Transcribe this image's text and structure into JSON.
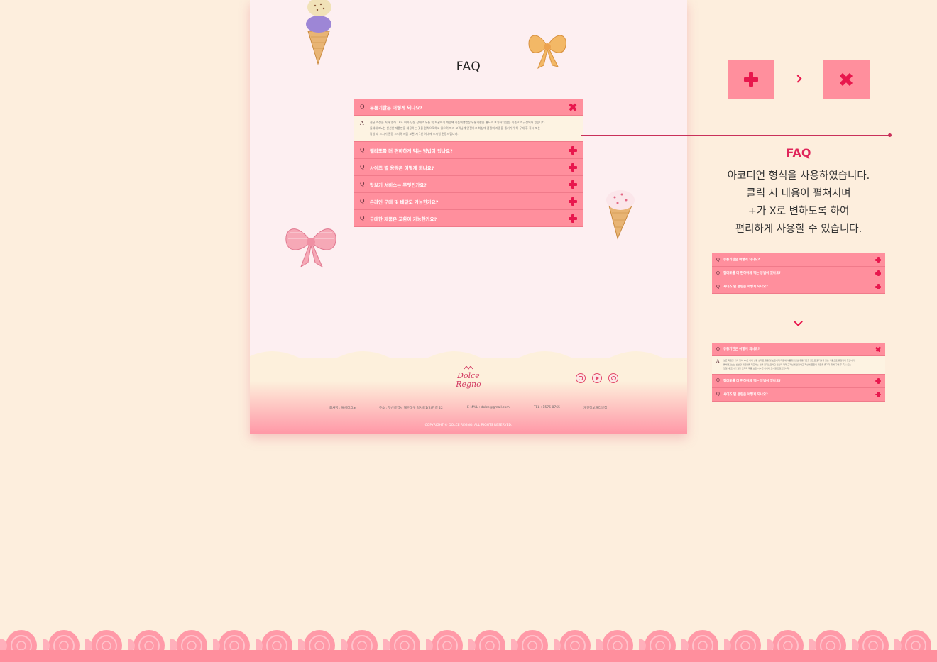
{
  "mockup": {
    "title": "FAQ",
    "faq": [
      {
        "q": "Q",
        "text": "유통기한은 어떻게 되나요?",
        "open": true
      },
      {
        "q": "Q",
        "text": "젤라또를 더 편하하게 먹는 방법이 있나요?",
        "open": false
      },
      {
        "q": "Q",
        "text": "사이즈 별 용량은 어떻게 되나요?",
        "open": false
      },
      {
        "q": "Q",
        "text": "맛보기 서비스는 무엇인가요?",
        "open": false
      },
      {
        "q": "Q",
        "text": "온라인 구매 및 배달도 가능한가요?",
        "open": false
      },
      {
        "q": "Q",
        "text": "구매한 제품은 교환이 가능한가요?",
        "open": false
      }
    ],
    "answer": {
      "a": "A",
      "lines": [
        "설균 과정을 거쳐 영하 18도 이하 냉동 상태로 유통 및 보관하기 때문에 식품위생법상 유통기한을 별도로 표기하지 않는 식품으로 규정되어 있습니다.",
        "돌체레그노는 신선한 제품만을 제공하는 것을 원칙으로하고 있으며 따라 고객님께 안전하고 최상에 품질의 제품을 즐기기 위해 구매 후 즉시 또는",
        "당일 내 드시기 권장 드리며 제품 보관 시 1년 이내에 드시길 권장드립니다."
      ]
    },
    "footer": {
      "logo_text": "Dolce Regno",
      "company": "회사명 : 돌체레그노",
      "address": "주소 : 부산광역시 해운대구 림서로1(2)관길 22",
      "email": "E-MAIL : dolce@gmail.com",
      "tel": "TEL : 1576-8765",
      "privacy": "개인정보처리방침",
      "copyright": "COPYRIGHT © DOLCE REGNO. ALL RIGHTS RESERVED.",
      "social_icons": [
        "instagram-icon",
        "youtube-icon",
        "talk-icon"
      ]
    }
  },
  "explanation": {
    "title": "FAQ",
    "lines": [
      "아코디언 형식을 사용하였습니다.",
      "클릭 시 내용이 펼쳐지며",
      "+가 X로 변하도록 하여",
      "편리하게 사용할 수 있습니다."
    ],
    "closed_example": [
      "유통기한은 어떻게 되나요?",
      "젤라또를 더 편하하게 먹는 방법이 있나요?",
      "사이즈 별 용량은 어떻게 되나요?"
    ],
    "open_example": {
      "first": "유통기한은 어떻게 되나요?",
      "rest": [
        "젤라또를 더 편하하게 먹는 방법이 있나요?",
        "사이즈 별 용량은 어떻게 되나요?"
      ]
    }
  },
  "colors": {
    "accent": "#e8174d",
    "faq_bar": "#ff8f9d",
    "answer_bg": "#fdf3e2",
    "page_bg": "#fdeedd"
  }
}
